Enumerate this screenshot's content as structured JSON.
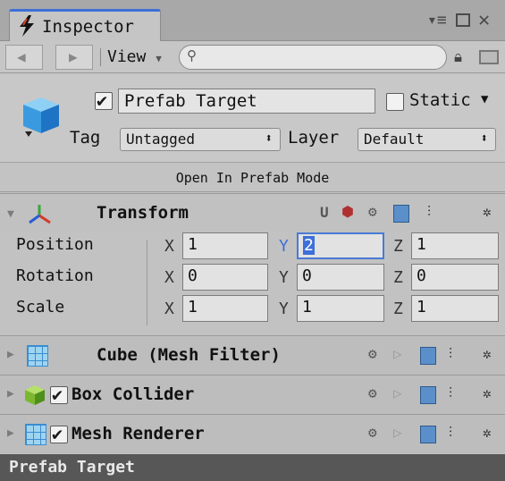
{
  "tab": {
    "label": "Inspector"
  },
  "toolbar": {
    "view_label": "View",
    "search_placeholder": ""
  },
  "header": {
    "object_name": "Prefab Target",
    "static_label": "Static",
    "tag_label": "Tag",
    "tag_value": "Untagged",
    "layer_label": "Layer",
    "layer_value": "Default",
    "prefab_mode_label": "Open In Prefab Mode"
  },
  "transform": {
    "title": "Transform",
    "rows": [
      {
        "label": "Position",
        "x": "1",
        "y": "2",
        "z": "1"
      },
      {
        "label": "Rotation",
        "x": "0",
        "y": "0",
        "z": "0"
      },
      {
        "label": "Scale",
        "x": "1",
        "y": "1",
        "z": "1"
      }
    ],
    "axis_x": "X",
    "axis_y": "Y",
    "axis_z": "Z"
  },
  "components": [
    {
      "title": "Cube (Mesh Filter)"
    },
    {
      "title": "Box Collider"
    },
    {
      "title": "Mesh Renderer"
    }
  ],
  "footer": {
    "label": "Prefab Target"
  },
  "colors": {
    "accent": "#3d6fd8",
    "footer_bg": "#575757",
    "selected_field": "#4a7ad6"
  }
}
